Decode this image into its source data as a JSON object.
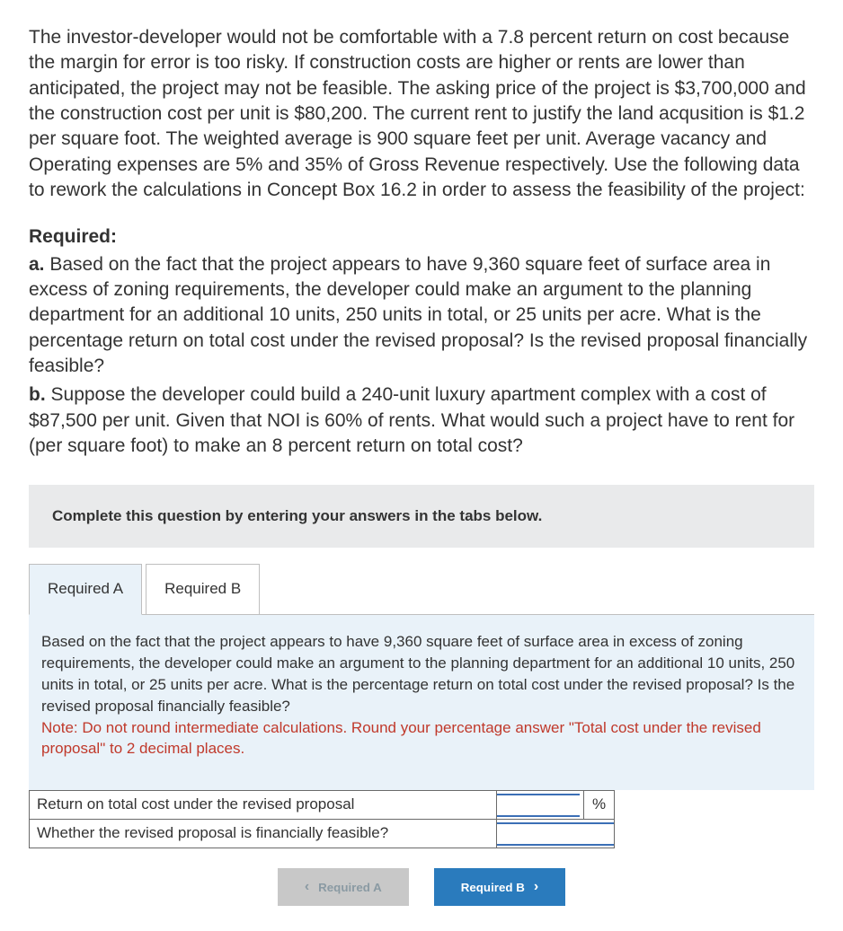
{
  "problem": {
    "intro": "The investor-developer would not be comfortable with a 7.8 percent return on cost because the margin for error is too risky. If construction costs are higher or rents are lower than anticipated, the project may not be feasible. The asking price of the project is $3,700,000 and the construction cost per unit is $80,200. The current rent to justify the land acqusition is $1.2 per square foot. The weighted average is 900 square feet per unit. Average vacancy and Operating expenses are 5% and 35% of Gross Revenue respectively. Use the following data to rework the calculations in Concept Box 16.2 in order to assess the feasibility of the project:",
    "required_label": "Required:",
    "a_lead": "a.",
    "a_text": " Based on the fact that the project appears to have 9,360 square feet of surface area in excess of zoning requirements, the developer could make an argument to the planning department for an additional 10 units, 250 units in total, or 25 units per acre. What is the percentage return on total cost under the revised proposal? Is the revised proposal financially feasible?",
    "b_lead": "b.",
    "b_text": " Suppose the developer could build a 240-unit luxury apartment complex with a cost of $87,500 per unit. Given that NOI is 60% of rents. What would such a project have to rent for (per square foot) to make an 8 percent return on total cost?"
  },
  "instruction": "Complete this question by entering your answers in the tabs below.",
  "tabs": {
    "a": "Required A",
    "b": "Required B"
  },
  "panel": {
    "prompt": "Based on the fact that the project appears to have 9,360 square feet of surface area in excess of zoning requirements, the developer could make an argument to the planning department for an additional 10 units, 250 units in total, or 25 units per acre. What is the percentage return on total cost under the revised proposal? Is the revised proposal financially feasible?",
    "note": "Note: Do not round intermediate calculations. Round your percentage answer \"Total cost under the revised proposal\" to 2 decimal places."
  },
  "answers": {
    "row1_label": "Return on total cost under the revised proposal",
    "row1_value": "",
    "row1_unit": "%",
    "row2_label": "Whether the revised proposal is financially feasible?",
    "row2_value": ""
  },
  "nav": {
    "prev": "Required A",
    "next": "Required B"
  }
}
